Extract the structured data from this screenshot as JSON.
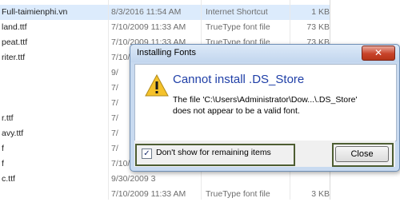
{
  "file_list": {
    "rows": [
      {
        "name": "Full-taimienphi.vn",
        "date": "8/3/2016 11:54 AM",
        "type": "Internet Shortcut",
        "size": "1 KB",
        "selected": true
      },
      {
        "name": "land.ttf",
        "date": "7/10/2009 11:33 AM",
        "type": "TrueType font file",
        "size": "73 KB"
      },
      {
        "name": "peat.ttf",
        "date": "7/10/2009 11:33 AM",
        "type": "TrueType font file",
        "size": "73 KB"
      },
      {
        "name": "riter.ttf",
        "date": "7/10/2009 11:33 AM",
        "type": "TrueType font file",
        "size": "73 KB"
      },
      {
        "name": "",
        "date": "9/",
        "type": "",
        "size": ""
      },
      {
        "name": "",
        "date": "7/",
        "type": "",
        "size": ""
      },
      {
        "name": "",
        "date": "7/",
        "type": "",
        "size": ""
      },
      {
        "name": "r.ttf",
        "date": "7/",
        "type": "",
        "size": ""
      },
      {
        "name": "avy.ttf",
        "date": "7/",
        "type": "",
        "size": ""
      },
      {
        "name": "f",
        "date": "7/",
        "type": "",
        "size": ""
      },
      {
        "name": "f",
        "date": "7/10/2009 1",
        "type": "",
        "size": ""
      },
      {
        "name": "c.ttf",
        "date": "9/30/2009 3",
        "type": "",
        "size": ""
      },
      {
        "name": "",
        "date": "7/10/2009 11:33 AM",
        "type": "TrueType font file",
        "size": "3 KB"
      }
    ]
  },
  "dialog": {
    "title": "Installing Fonts",
    "close_glyph": "✕",
    "main_instruction": "Cannot install .DS_Store",
    "content_line1": "The file 'C:\\Users\\Administrator\\Dow...\\.DS_Store'",
    "content_line2": "does not appear to be a valid font.",
    "checkbox_label": "Don't show for remaining items",
    "checkbox_checked": true,
    "checkbox_glyph": "✓",
    "close_button": "Close"
  },
  "colors": {
    "instruction": "#1f3fa7",
    "highlight_border": "#4d5d32",
    "selected_row": "#dcebfc"
  }
}
